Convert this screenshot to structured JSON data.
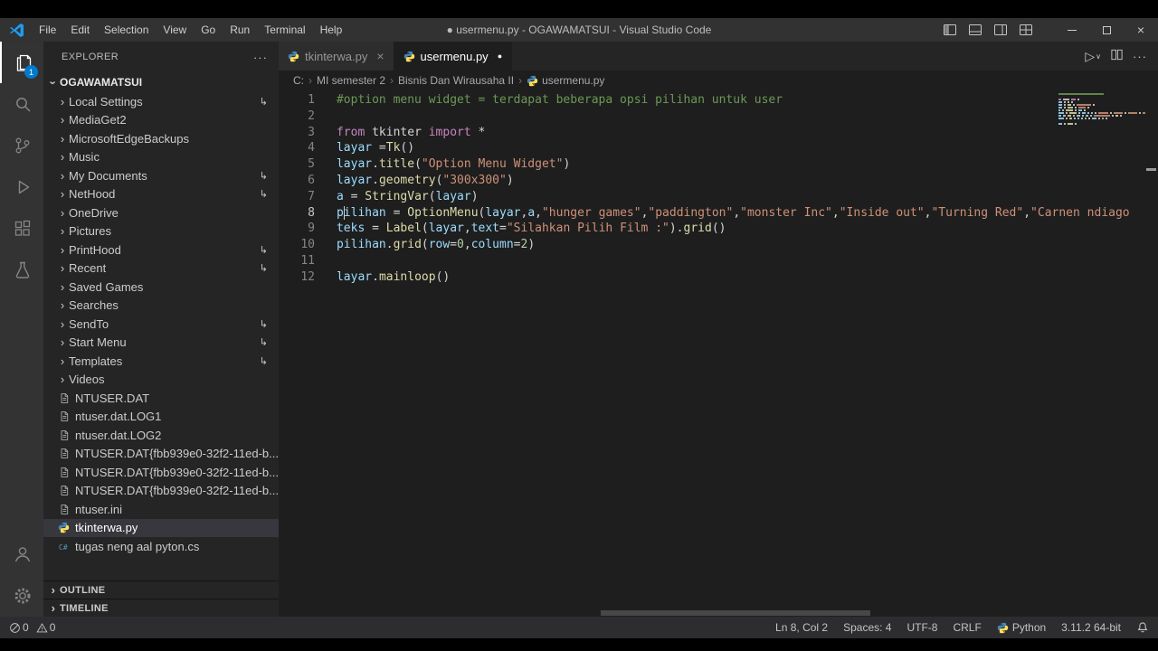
{
  "titlebar": {
    "title": "● usermenu.py - OGAWAMATSUI - Visual Studio Code",
    "menus": [
      "File",
      "Edit",
      "Selection",
      "View",
      "Go",
      "Run",
      "Terminal",
      "Help"
    ]
  },
  "activitybar": {
    "badge": "1"
  },
  "sidebar": {
    "title": "EXPLORER",
    "more": "···",
    "root": "OGAWAMATSUI",
    "items": [
      {
        "label": "Local Settings",
        "kind": "folder",
        "shortcut": true
      },
      {
        "label": "MediaGet2",
        "kind": "folder"
      },
      {
        "label": "MicrosoftEdgeBackups",
        "kind": "folder"
      },
      {
        "label": "Music",
        "kind": "folder"
      },
      {
        "label": "My Documents",
        "kind": "folder",
        "shortcut": true
      },
      {
        "label": "NetHood",
        "kind": "folder",
        "shortcut": true
      },
      {
        "label": "OneDrive",
        "kind": "folder"
      },
      {
        "label": "Pictures",
        "kind": "folder"
      },
      {
        "label": "PrintHood",
        "kind": "folder",
        "shortcut": true
      },
      {
        "label": "Recent",
        "kind": "folder",
        "shortcut": true
      },
      {
        "label": "Saved Games",
        "kind": "folder"
      },
      {
        "label": "Searches",
        "kind": "folder"
      },
      {
        "label": "SendTo",
        "kind": "folder",
        "shortcut": true
      },
      {
        "label": "Start Menu",
        "kind": "folder",
        "shortcut": true
      },
      {
        "label": "Templates",
        "kind": "folder",
        "shortcut": true
      },
      {
        "label": "Videos",
        "kind": "folder"
      },
      {
        "label": "NTUSER.DAT",
        "kind": "file",
        "icon": "file"
      },
      {
        "label": "ntuser.dat.LOG1",
        "kind": "file",
        "icon": "file"
      },
      {
        "label": "ntuser.dat.LOG2",
        "kind": "file",
        "icon": "file"
      },
      {
        "label": "NTUSER.DAT{fbb939e0-32f2-11ed-b...",
        "kind": "file",
        "icon": "file"
      },
      {
        "label": "NTUSER.DAT{fbb939e0-32f2-11ed-b...",
        "kind": "file",
        "icon": "file"
      },
      {
        "label": "NTUSER.DAT{fbb939e0-32f2-11ed-b...",
        "kind": "file",
        "icon": "file"
      },
      {
        "label": "ntuser.ini",
        "kind": "file",
        "icon": "file"
      },
      {
        "label": "tkinterwa.py",
        "kind": "file",
        "icon": "python",
        "selected": true
      },
      {
        "label": "tugas neng aal pyton.cs",
        "kind": "file",
        "icon": "csharp"
      }
    ],
    "sections": [
      {
        "label": "OUTLINE"
      },
      {
        "label": "TIMELINE"
      }
    ]
  },
  "editor": {
    "tabs": [
      {
        "label": "tkinterwa.py",
        "icon": "python",
        "active": false,
        "close": "×"
      },
      {
        "label": "usermenu.py",
        "icon": "python",
        "active": true,
        "modified": "●"
      }
    ],
    "actions": {
      "run": "▷",
      "run_caret": "∨",
      "more": "···"
    },
    "breadcrumb": [
      {
        "label": "C:"
      },
      {
        "label": "MI semester 2"
      },
      {
        "label": "Bisnis Dan Wirausaha II"
      },
      {
        "label": "usermenu.py",
        "icon": "python"
      }
    ],
    "cursor": {
      "line": 8,
      "col": 2
    },
    "token_colors": {
      "cm": "#6A9955",
      "kw": "#C586C0",
      "var": "#9CDCFE",
      "fn": "#DCDCAA",
      "str": "#CE9178",
      "num": "#B5CEA8",
      "pl": "#D4D4D4"
    },
    "lines": [
      {
        "n": 1,
        "tokens": [
          {
            "t": "#option menu widget = terdapat beberapa opsi pilihan untuk user",
            "c": "cm"
          }
        ]
      },
      {
        "n": 2,
        "tokens": []
      },
      {
        "n": 3,
        "tokens": [
          {
            "t": "from",
            "c": "kw"
          },
          {
            "t": " tkinter ",
            "c": "pl"
          },
          {
            "t": "import",
            "c": "kw"
          },
          {
            "t": " *",
            "c": "pl"
          }
        ]
      },
      {
        "n": 4,
        "tokens": [
          {
            "t": "layar",
            "c": "var"
          },
          {
            "t": " =",
            "c": "pl"
          },
          {
            "t": "Tk",
            "c": "fn"
          },
          {
            "t": "()",
            "c": "pl"
          }
        ]
      },
      {
        "n": 5,
        "tokens": [
          {
            "t": "layar",
            "c": "var"
          },
          {
            "t": ".",
            "c": "pl"
          },
          {
            "t": "title",
            "c": "fn"
          },
          {
            "t": "(",
            "c": "pl"
          },
          {
            "t": "\"Option Menu Widget\"",
            "c": "str"
          },
          {
            "t": ")",
            "c": "pl"
          }
        ]
      },
      {
        "n": 6,
        "tokens": [
          {
            "t": "layar",
            "c": "var"
          },
          {
            "t": ".",
            "c": "pl"
          },
          {
            "t": "geometry",
            "c": "fn"
          },
          {
            "t": "(",
            "c": "pl"
          },
          {
            "t": "\"300x300\"",
            "c": "str"
          },
          {
            "t": ")",
            "c": "pl"
          }
        ]
      },
      {
        "n": 7,
        "tokens": [
          {
            "t": "a",
            "c": "var"
          },
          {
            "t": " = ",
            "c": "pl"
          },
          {
            "t": "StringVar",
            "c": "fn"
          },
          {
            "t": "(",
            "c": "pl"
          },
          {
            "t": "layar",
            "c": "var"
          },
          {
            "t": ")",
            "c": "pl"
          }
        ]
      },
      {
        "n": 8,
        "tokens": [
          {
            "t": "pilihan",
            "c": "var"
          },
          {
            "t": " = ",
            "c": "pl"
          },
          {
            "t": "OptionMenu",
            "c": "fn"
          },
          {
            "t": "(",
            "c": "pl"
          },
          {
            "t": "layar",
            "c": "var"
          },
          {
            "t": ",",
            "c": "pl"
          },
          {
            "t": "a",
            "c": "var"
          },
          {
            "t": ",",
            "c": "pl"
          },
          {
            "t": "\"hunger games\"",
            "c": "str"
          },
          {
            "t": ",",
            "c": "pl"
          },
          {
            "t": "\"paddington\"",
            "c": "str"
          },
          {
            "t": ",",
            "c": "pl"
          },
          {
            "t": "\"monster Inc\"",
            "c": "str"
          },
          {
            "t": ",",
            "c": "pl"
          },
          {
            "t": "\"Inside out\"",
            "c": "str"
          },
          {
            "t": ",",
            "c": "pl"
          },
          {
            "t": "\"Turning Red\"",
            "c": "str"
          },
          {
            "t": ",",
            "c": "pl"
          },
          {
            "t": "\"Carnen ndiago",
            "c": "str"
          }
        ]
      },
      {
        "n": 9,
        "tokens": [
          {
            "t": "teks",
            "c": "var"
          },
          {
            "t": " = ",
            "c": "pl"
          },
          {
            "t": "Label",
            "c": "fn"
          },
          {
            "t": "(",
            "c": "pl"
          },
          {
            "t": "layar",
            "c": "var"
          },
          {
            "t": ",",
            "c": "pl"
          },
          {
            "t": "text",
            "c": "var"
          },
          {
            "t": "=",
            "c": "pl"
          },
          {
            "t": "\"Silahkan Pilih Film :\"",
            "c": "str"
          },
          {
            "t": ").",
            "c": "pl"
          },
          {
            "t": "grid",
            "c": "fn"
          },
          {
            "t": "()",
            "c": "pl"
          }
        ]
      },
      {
        "n": 10,
        "tokens": [
          {
            "t": "pilihan",
            "c": "var"
          },
          {
            "t": ".",
            "c": "pl"
          },
          {
            "t": "grid",
            "c": "fn"
          },
          {
            "t": "(",
            "c": "pl"
          },
          {
            "t": "row",
            "c": "var"
          },
          {
            "t": "=",
            "c": "pl"
          },
          {
            "t": "0",
            "c": "num"
          },
          {
            "t": ",",
            "c": "pl"
          },
          {
            "t": "column",
            "c": "var"
          },
          {
            "t": "=",
            "c": "pl"
          },
          {
            "t": "2",
            "c": "num"
          },
          {
            "t": ")",
            "c": "pl"
          }
        ]
      },
      {
        "n": 11,
        "tokens": []
      },
      {
        "n": 12,
        "tokens": [
          {
            "t": "layar",
            "c": "var"
          },
          {
            "t": ".",
            "c": "pl"
          },
          {
            "t": "mainloop",
            "c": "fn"
          },
          {
            "t": "()",
            "c": "pl"
          }
        ]
      }
    ]
  },
  "statusbar": {
    "problems": [
      {
        "name": "errors",
        "count": "0"
      },
      {
        "name": "warnings",
        "count": "0"
      }
    ],
    "right": [
      "Ln 8, Col 2",
      "Spaces: 4",
      "UTF-8",
      "CRLF",
      "Python",
      "3.11.2 64-bit"
    ]
  }
}
